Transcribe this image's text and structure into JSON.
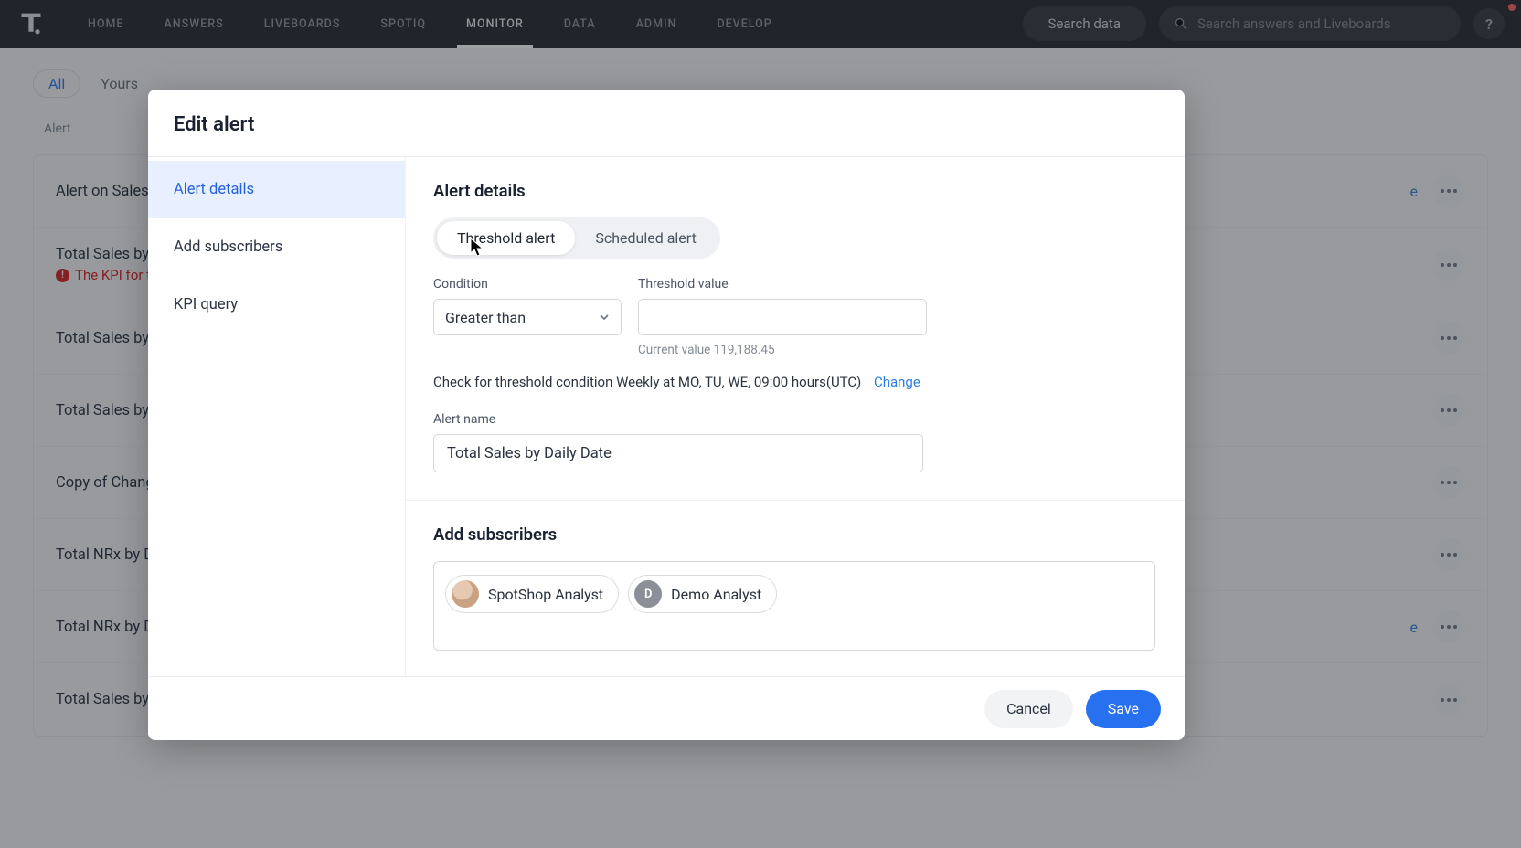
{
  "nav": {
    "items": [
      "HOME",
      "ANSWERS",
      "LIVEBOARDS",
      "SPOTIQ",
      "MONITOR",
      "DATA",
      "ADMIN",
      "DEVELOP"
    ],
    "active_index": 4,
    "search_data_label": "Search data",
    "global_search_placeholder": "Search answers and Liveboards",
    "help_label": "?"
  },
  "bg": {
    "tabs": {
      "all": "All",
      "yours": "Yours"
    },
    "col_header": "Alert",
    "rows": [
      {
        "title": "Alert on Sales b",
        "warn": "",
        "right_e": true
      },
      {
        "title": "Total Sales by D",
        "warn": "The KPI for th deleted",
        "right_e": false
      },
      {
        "title": "Total Sales by D",
        "warn": "",
        "right_e": false
      },
      {
        "title": "Total Sales by D",
        "warn": "",
        "right_e": false
      },
      {
        "title": "Copy of Change",
        "warn": "",
        "right_e": false
      },
      {
        "title": "Total NRx by Da",
        "warn": "",
        "right_e": false
      },
      {
        "title": "Total NRx by Da",
        "warn": "",
        "right_e": true
      },
      {
        "title": "Total Sales by D",
        "warn": "",
        "right_e": false
      }
    ]
  },
  "modal": {
    "title": "Edit alert",
    "sidebar": {
      "items": [
        {
          "key": "details",
          "label": "Alert details"
        },
        {
          "key": "subs",
          "label": "Add subscribers"
        },
        {
          "key": "kpi",
          "label": "KPI query"
        }
      ],
      "active_index": 0
    },
    "details": {
      "heading": "Alert details",
      "type_tabs": {
        "threshold": "Threshold alert",
        "scheduled": "Scheduled alert"
      },
      "condition_label": "Condition",
      "condition_value": "Greater than",
      "threshold_label": "Threshold value",
      "threshold_value": "",
      "current_value_hint": "Current value 119,188.45",
      "schedule_text": "Check for threshold condition Weekly at MO, TU, WE, 09:00 hours(UTC)",
      "change_label": "Change",
      "name_label": "Alert name",
      "name_value": "Total Sales by Daily Date"
    },
    "subscribers": {
      "heading": "Add subscribers",
      "chips": [
        {
          "label": "SpotShop Analyst",
          "avatar_type": "img",
          "avatar_letter": ""
        },
        {
          "label": "Demo Analyst",
          "avatar_type": "letter",
          "avatar_letter": "D"
        }
      ]
    },
    "footer": {
      "cancel": "Cancel",
      "save": "Save"
    }
  }
}
